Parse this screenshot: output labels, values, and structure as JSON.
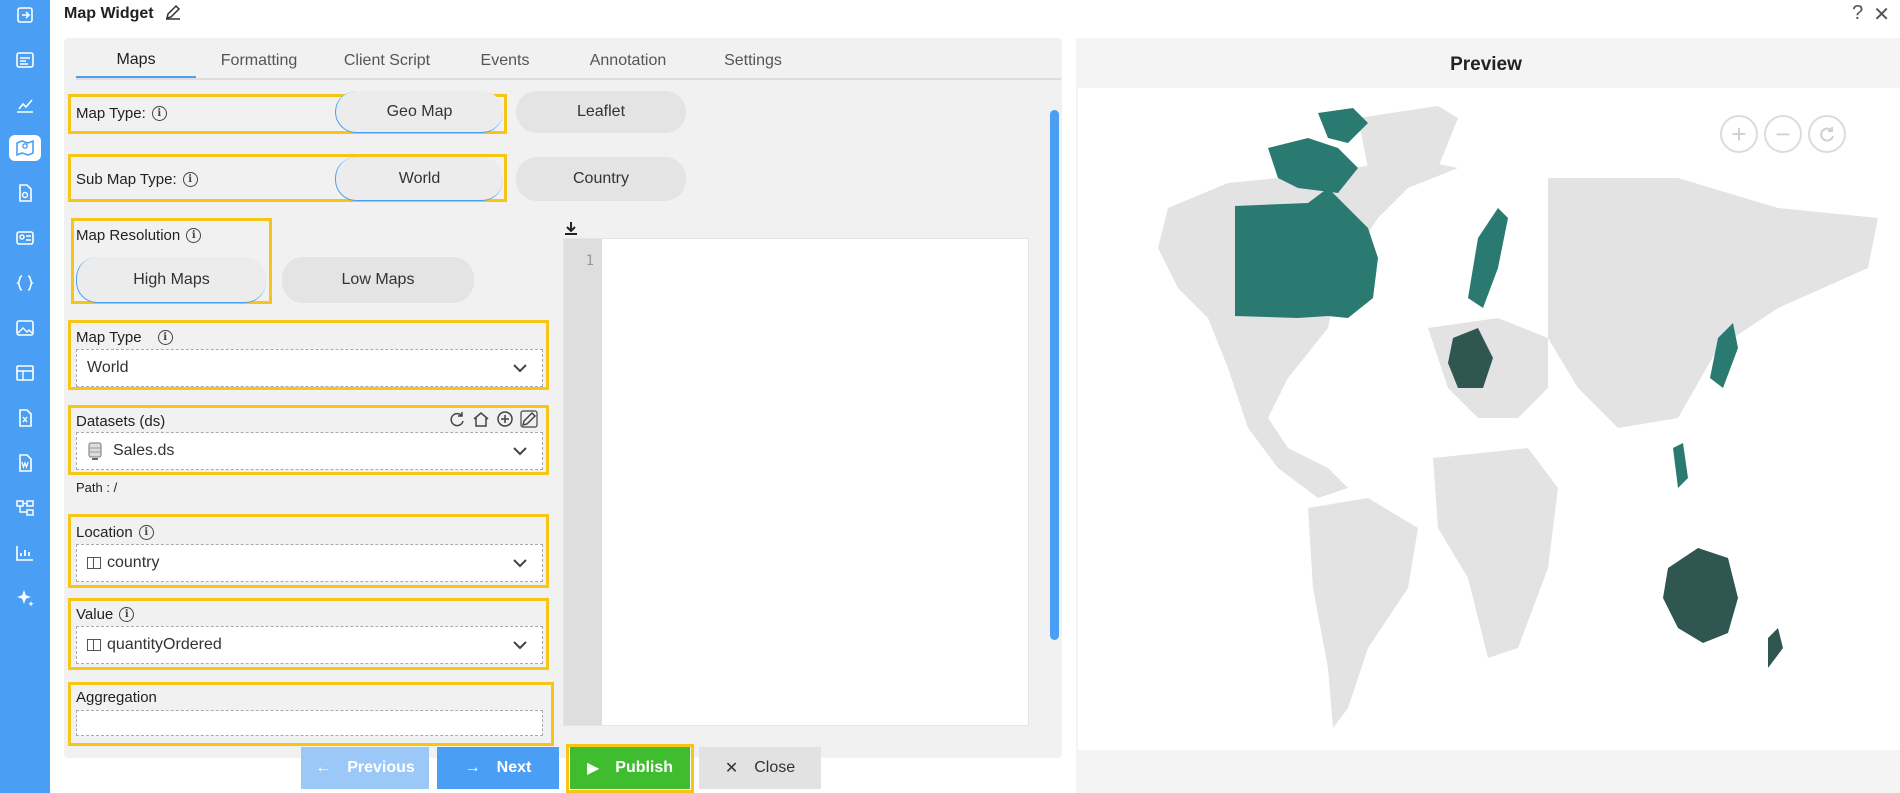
{
  "header": {
    "title": "Map Widget",
    "help": "?",
    "close": "✕"
  },
  "tabs": [
    "Maps",
    "Formatting",
    "Client Script",
    "Events",
    "Annotation",
    "Settings"
  ],
  "map_type_toggle": {
    "label": "Map Type:",
    "options": [
      "Geo Map",
      "Leaflet"
    ],
    "selected": "Geo Map"
  },
  "sub_map_type_toggle": {
    "label": "Sub Map Type:",
    "options": [
      "World",
      "Country"
    ],
    "selected": "World"
  },
  "map_resolution": {
    "label": "Map Resolution",
    "options": [
      "High Maps",
      "Low Maps"
    ],
    "selected": "High Maps"
  },
  "map_type_select": {
    "label": "Map Type",
    "value": "World"
  },
  "datasets": {
    "label": "Datasets (ds)",
    "value": "Sales.ds",
    "path": "Path : /"
  },
  "location": {
    "label": "Location",
    "value": "country"
  },
  "value_field": {
    "label": "Value",
    "value": "quantityOrdered"
  },
  "aggregation": {
    "label": "Aggregation",
    "value": ""
  },
  "editor": {
    "line_number": "1"
  },
  "footer": {
    "previous": "Previous",
    "next": "Next",
    "publish": "Publish",
    "close": "Close"
  },
  "preview": {
    "title": "Preview",
    "zoom_in": "+",
    "zoom_out": "−"
  },
  "colors": {
    "accent": "#4a9ff5",
    "highlight": "#f5c518",
    "publish": "#3fbd2e",
    "map_teal": "#2a7a72",
    "map_dark": "#2f5651",
    "map_land": "#e3e3e3"
  },
  "rail_icons": [
    "login-icon",
    "dashboard-icon",
    "chart-icon",
    "map-icon",
    "report-icon",
    "id-card-icon",
    "braces-icon",
    "image-icon",
    "table-icon",
    "excel-icon",
    "word-icon",
    "tree-icon",
    "analytics-icon",
    "sparkle-icon"
  ]
}
